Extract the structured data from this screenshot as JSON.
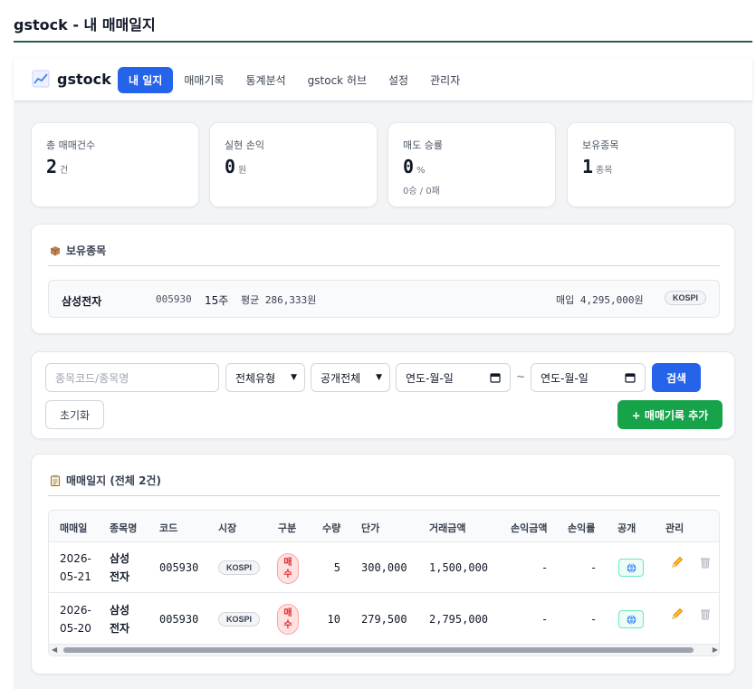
{
  "page": {
    "title": "gstock - 내 매매일지"
  },
  "nav": {
    "brand": "gstock",
    "tabs": [
      {
        "label": "내 일지",
        "active": true
      },
      {
        "label": "매매기록",
        "active": false
      },
      {
        "label": "통계분석",
        "active": false
      },
      {
        "label": "gstock 허브",
        "active": false
      },
      {
        "label": "설정",
        "active": false
      },
      {
        "label": "관리자",
        "active": false
      }
    ]
  },
  "stats": [
    {
      "label": "총 매매건수",
      "value": "2",
      "unit": "건",
      "sub": ""
    },
    {
      "label": "실현 손익",
      "value": "0",
      "unit": "원",
      "sub": ""
    },
    {
      "label": "매도 승률",
      "value": "0",
      "unit": "%",
      "sub": "0승 / 0패"
    },
    {
      "label": "보유종목",
      "value": "1",
      "unit": "종목",
      "sub": ""
    }
  ],
  "holdings": {
    "title": "보유종목",
    "items": [
      {
        "name": "삼성전자",
        "code": "005930",
        "qty": "15주",
        "avg": "평균 286,333원",
        "buy": "매입 4,295,000원",
        "market": "KOSPI"
      }
    ]
  },
  "filters": {
    "search_placeholder": "종목코드/종목명",
    "type_select": "전체유형",
    "public_select": "공개전체",
    "date_from": "연도-월-일",
    "date_to": "연도-월-일",
    "tilde": "~",
    "search_label": "검색",
    "reset_label": "초기화",
    "add_label": "+ 매매기록 추가"
  },
  "journal": {
    "title": "매매일지 (전체 2건)",
    "columns": [
      "매매일",
      "종목명",
      "코드",
      "시장",
      "구분",
      "수량",
      "단가",
      "거래금액",
      "손익금액",
      "손익률",
      "공개",
      "관리"
    ],
    "rows": [
      {
        "date1": "2026-",
        "date2": "05-21",
        "name1": "삼성",
        "name2": "전자",
        "code": "005930",
        "market": "KOSPI",
        "type1": "매",
        "type2": "수",
        "qty": "5",
        "price": "300,000",
        "amount": "1,500,000",
        "pnl": "-",
        "pnl_rate": "-"
      },
      {
        "date1": "2026-",
        "date2": "05-20",
        "name1": "삼성",
        "name2": "전자",
        "code": "005930",
        "market": "KOSPI",
        "type1": "매",
        "type2": "수",
        "qty": "10",
        "price": "279,500",
        "amount": "2,795,000",
        "pnl": "-",
        "pnl_rate": "-"
      }
    ]
  },
  "colors": {
    "primary": "#2563eb",
    "success": "#16a34a",
    "buy": "#dc2626",
    "title_rule": "#2f5a4e"
  },
  "icons": [
    "chart-icon",
    "package-icon",
    "clipboard-icon",
    "globe-icon",
    "pencil-icon",
    "trash-icon",
    "calendar-icon",
    "chevron-down-icon"
  ]
}
